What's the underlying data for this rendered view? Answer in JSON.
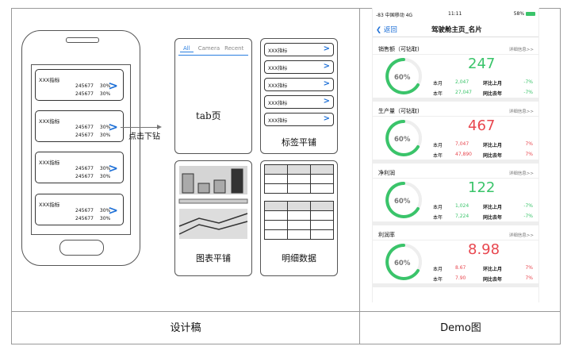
{
  "left_caption": "设计稿",
  "right_caption": "Demo图",
  "phone_cards": [
    {
      "title": "XXX指标",
      "row1": [
        "245677",
        "30%"
      ],
      "row2": [
        "245677",
        "30%"
      ]
    },
    {
      "title": "XXX指标",
      "row1": [
        "245677",
        "30%"
      ],
      "row2": [
        "245677",
        "30%"
      ]
    },
    {
      "title": "XXX指标",
      "row1": [
        "245677",
        "30%"
      ],
      "row2": [
        "245677",
        "30%"
      ]
    },
    {
      "title": "XXX指标",
      "row1": [
        "245677",
        "30%"
      ],
      "row2": [
        "245677",
        "30%"
      ]
    }
  ],
  "drilldown_label": "点击下钻",
  "tab_panel": {
    "tabs": [
      "All",
      "Camera",
      "Recent"
    ],
    "label": "tab页"
  },
  "tag_panel": {
    "items": [
      "XXX指标",
      "XXX指标",
      "XXX指标",
      "XXX指标",
      "XXX指标"
    ],
    "label": "标签平铺"
  },
  "chart_panel": {
    "label": "图表平铺"
  },
  "detail_panel": {
    "label": "明细数据"
  },
  "demo": {
    "status": {
      "carrier": "-83 中国移动  4G",
      "time": "11:11",
      "battery": "58%"
    },
    "nav": {
      "back": "返回",
      "title": "驾驶舱主页_名片"
    },
    "more_label": "详细信息>>",
    "labels": {
      "month": "本月",
      "year": "本年",
      "mom": "环比上月",
      "yoy": "同比去年"
    },
    "cards": [
      {
        "name": "销售额（可钻取)",
        "big": "247",
        "big_color": "#3ac46a",
        "gauge": "60%",
        "month": "2,047",
        "year": "27,047",
        "mom": "-7%",
        "yoy": "-7%",
        "val_color": "#3ac46a"
      },
      {
        "name": "生产量（可钻取)",
        "big": "467",
        "big_color": "#e8474f",
        "gauge": "60%",
        "month": "7,047",
        "year": "47,890",
        "mom": "7%",
        "yoy": "7%",
        "val_color": "#e8474f"
      },
      {
        "name": "净利润",
        "big": "122",
        "big_color": "#3ac46a",
        "gauge": "60%",
        "month": "1,024",
        "year": "7,224",
        "mom": "-7%",
        "yoy": "-7%",
        "val_color": "#3ac46a"
      },
      {
        "name": "利润率",
        "big": "8.98",
        "big_color": "#e8474f",
        "gauge": "60%",
        "month": "8.67",
        "year": "7.90",
        "mom": "7%",
        "yoy": "7%",
        "val_color": "#e8474f"
      }
    ]
  }
}
